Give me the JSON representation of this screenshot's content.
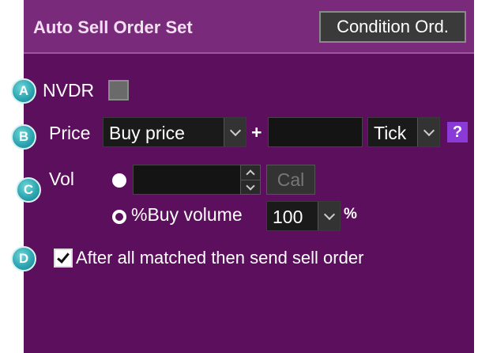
{
  "header": {
    "title": "Auto Sell Order Set",
    "condition_button": "Condition Ord."
  },
  "markers": {
    "a": "A",
    "b": "B",
    "c": "C",
    "d": "D"
  },
  "nvdr": {
    "label": "NVDR",
    "checked": false
  },
  "price": {
    "label": "Price",
    "base_selected": "Buy price",
    "plus": "+",
    "offset_value": "",
    "unit_selected": "Tick",
    "help": "?"
  },
  "vol": {
    "label": "Vol",
    "value_input": "",
    "cal_button": "Cal",
    "percent_option_label": "%Buy volume",
    "percent_selected": "100",
    "percent_sign": "%"
  },
  "send_after_match": {
    "label": "After all matched then send sell order",
    "checked": true
  },
  "colors": {
    "panel_bg": "#5c0f5c",
    "title_bar_bg": "#7a2a7a",
    "marker": "#2fa6b2",
    "help_icon": "#8a3ad6"
  },
  "icons": [
    "chevron-down-icon",
    "chevron-up-icon",
    "help-icon",
    "check-icon"
  ]
}
